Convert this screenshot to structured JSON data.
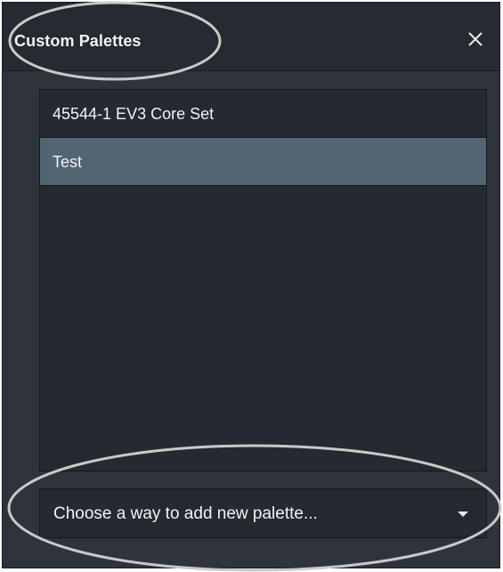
{
  "dialog": {
    "title": "Custom Palettes",
    "close_icon": "close-icon"
  },
  "palette_list": {
    "items": [
      {
        "label": "45544-1 EV3 Core Set",
        "selected": false
      },
      {
        "label": "Test",
        "selected": true
      }
    ]
  },
  "add_palette": {
    "placeholder": "Choose a way to add new palette...",
    "icon": "chevron-down-icon"
  },
  "colors": {
    "panel_bg": "#2f333b",
    "header_bg": "#262a31",
    "list_bg": "#252930",
    "selected_bg": "#536473",
    "text": "#f2f3f5",
    "annotation_stroke": "#c9c9c9"
  }
}
